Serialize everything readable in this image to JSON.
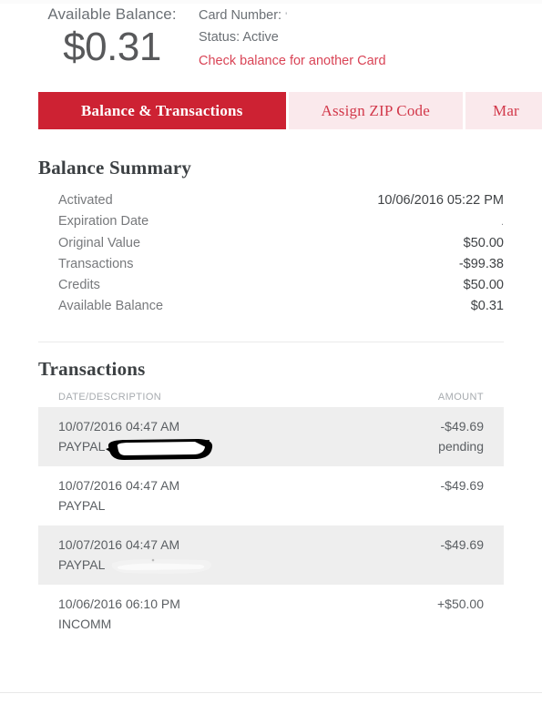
{
  "header": {
    "balance_label": "Available Balance:",
    "balance_amount": "$0.31",
    "card_number_label": "Card Number:",
    "card_number_value": "'",
    "status_line": "Status: Active",
    "check_balance_link": "Check balance for another Card"
  },
  "tabs": [
    {
      "label": "Balance & Transactions",
      "active": true
    },
    {
      "label": "Assign ZIP Code",
      "active": false
    },
    {
      "label": "Mar",
      "active": false
    }
  ],
  "balance_summary": {
    "title": "Balance Summary",
    "rows": [
      {
        "label": "Activated",
        "value": "10/06/2016 05:22 PM"
      },
      {
        "label": "Expiration Date",
        "value": "."
      },
      {
        "label": "Original Value",
        "value": "$50.00"
      },
      {
        "label": "Transactions",
        "value": "-$99.38"
      },
      {
        "label": "Credits",
        "value": "$50.00"
      },
      {
        "label": "Available Balance",
        "value": "$0.31"
      }
    ]
  },
  "transactions": {
    "title": "Transactions",
    "columns": {
      "description": "DATE/DESCRIPTION",
      "amount": "AMOUNT"
    },
    "rows": [
      {
        "date": "10/07/2016 04:47 AM",
        "description": "PAYPAL",
        "amount": "-$49.69",
        "status": "pending",
        "redaction": "black-marker"
      },
      {
        "date": "10/07/2016 04:47 AM",
        "description": "PAYPAL",
        "amount": "-$49.69",
        "status": "",
        "redaction": "none"
      },
      {
        "date": "10/07/2016 04:47 AM",
        "description": "PAYPAL",
        "amount": "-$49.69",
        "status": "",
        "redaction": "white-marker"
      },
      {
        "date": "10/06/2016 06:10 PM",
        "description": "INCOMM",
        "amount": "+$50.00",
        "status": "",
        "redaction": "none"
      }
    ]
  },
  "colors": {
    "accent_red": "#cd2233",
    "tab_inactive_bg": "#fae9ec",
    "tab_inactive_text": "#d2384a",
    "link_red": "#d94456",
    "row_shade": "#eeeeee",
    "text_gray": "#5b5f63"
  }
}
